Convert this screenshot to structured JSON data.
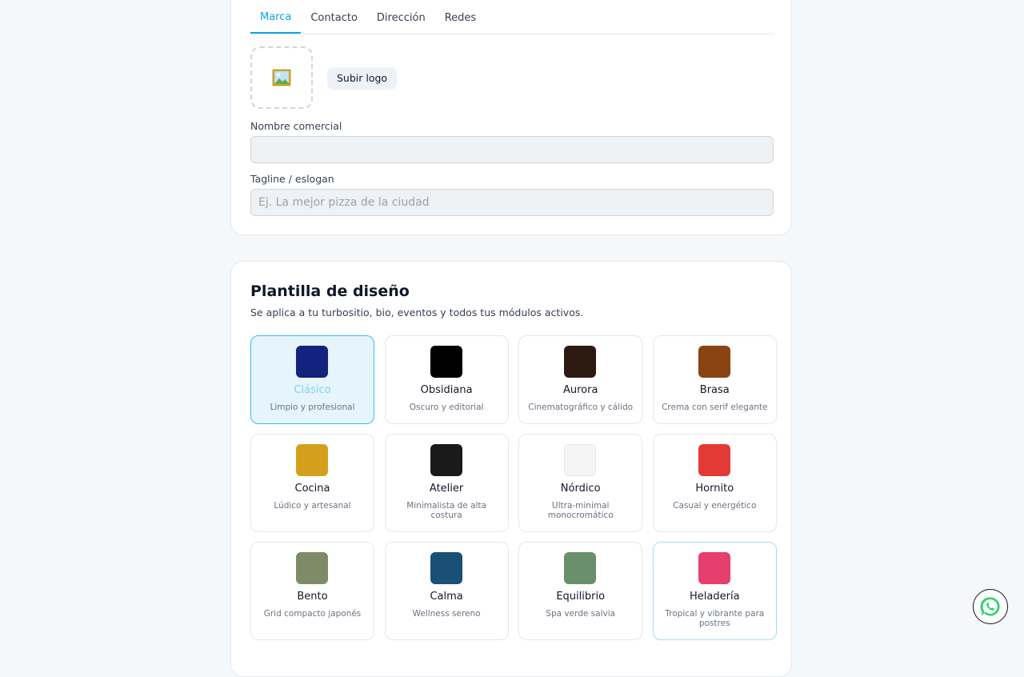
{
  "brand": {
    "tabs": [
      {
        "label": "Marca"
      },
      {
        "label": "Contacto"
      },
      {
        "label": "Dirección"
      },
      {
        "label": "Redes"
      }
    ],
    "logo_icon": "framed-picture-icon",
    "upload_label": "Subir logo",
    "name_label": "Nombre comercial",
    "name_value": "",
    "name_placeholder": "",
    "tagline_label": "Tagline / eslogan",
    "tagline_value": "",
    "tagline_placeholder": "Ej. La mejor pizza de la ciudad"
  },
  "templates": {
    "title": "Plantilla de diseño",
    "subtitle": "Se aplica a tu turbositio, bio, eventos y todos tus módulos activos.",
    "selected": "Clásico",
    "items": [
      {
        "name": "Clásico",
        "desc": "Limpio y profesional",
        "color": "#13227d"
      },
      {
        "name": "Obsidiana",
        "desc": "Oscuro y editorial",
        "color": "#000000"
      },
      {
        "name": "Aurora",
        "desc": "Cinematográfico y cálido",
        "color": "#2c1a10"
      },
      {
        "name": "Brasa",
        "desc": "Crema con serif elegante",
        "color": "#8a4312"
      },
      {
        "name": "Cocina",
        "desc": "Lúdico y artesanal",
        "color": "#d4a01c"
      },
      {
        "name": "Atelier",
        "desc": "Minimalista de alta costura",
        "color": "#1a1a1a"
      },
      {
        "name": "Nórdico",
        "desc": "Ultra-minimal monocromático",
        "color": "#f5f5f5"
      },
      {
        "name": "Hornito",
        "desc": "Casual y energético",
        "color": "#e33a35"
      },
      {
        "name": "Bento",
        "desc": "Grid compacto japonés",
        "color": "#7e8b69"
      },
      {
        "name": "Calma",
        "desc": "Wellness sereno",
        "color": "#1b5076"
      },
      {
        "name": "Equilibrio",
        "desc": "Spa verde salvia",
        "color": "#6a8f6b"
      },
      {
        "name": "Heladería",
        "desc": "Tropical y vibrante para postres",
        "color": "#e63e6d"
      }
    ]
  },
  "whatsapp_icon": "whatsapp-icon"
}
